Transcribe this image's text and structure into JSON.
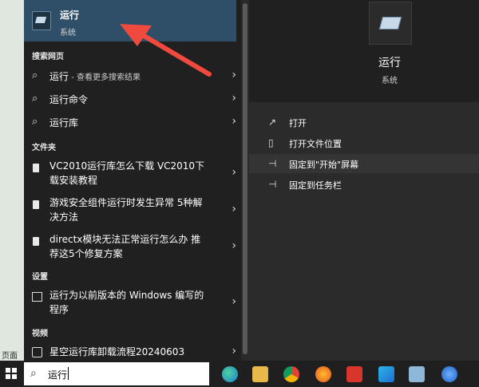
{
  "desktop": {
    "edge_label": "页面"
  },
  "best_match": {
    "title": "运行",
    "subtitle": "系统",
    "icon": "run-app-icon"
  },
  "sections": {
    "web": "搜索网页",
    "folders": "文件夹",
    "settings": "设置",
    "videos": "视频"
  },
  "web_results": [
    {
      "label": "运行",
      "hint": " - 查看更多搜索结果"
    },
    {
      "label": "运行命令",
      "hint": ""
    },
    {
      "label": "运行库",
      "hint": ""
    }
  ],
  "folder_results": [
    {
      "line1": "VC2010运行库怎么下载 VC2010下",
      "line2": "载安装教程"
    },
    {
      "line1": "游戏安全组件运行时发生异常 5种解",
      "line2": "决方法"
    },
    {
      "line1": "directx模块无法正常运行怎么办 推",
      "line2": "荐这5个修复方案"
    }
  ],
  "settings_results": [
    {
      "line1": "运行为以前版本的 Windows 编写的",
      "line2": "程序"
    }
  ],
  "video_results": [
    {
      "line1": "星空运行库卸载流程20240603"
    }
  ],
  "preview": {
    "title": "运行",
    "subtitle": "系统",
    "actions": [
      {
        "label": "打开",
        "icon": "open-icon"
      },
      {
        "label": "打开文件位置",
        "icon": "file-location-icon"
      },
      {
        "label": "固定到\"开始\"屏幕",
        "icon": "pin-icon"
      },
      {
        "label": "固定到任务栏",
        "icon": "pin-icon"
      }
    ]
  },
  "taskbar": {
    "search_query": "运行",
    "icons": [
      "edge-icon",
      "file-explorer-icon",
      "chrome-icon",
      "firefox-icon",
      "wps-icon",
      "app-icon",
      "run-icon",
      "security-icon"
    ]
  },
  "colors": {
    "selected_bg": "#2f4f69",
    "annotation_arrow": "#f04a3e",
    "panel_bg": "#202020"
  }
}
